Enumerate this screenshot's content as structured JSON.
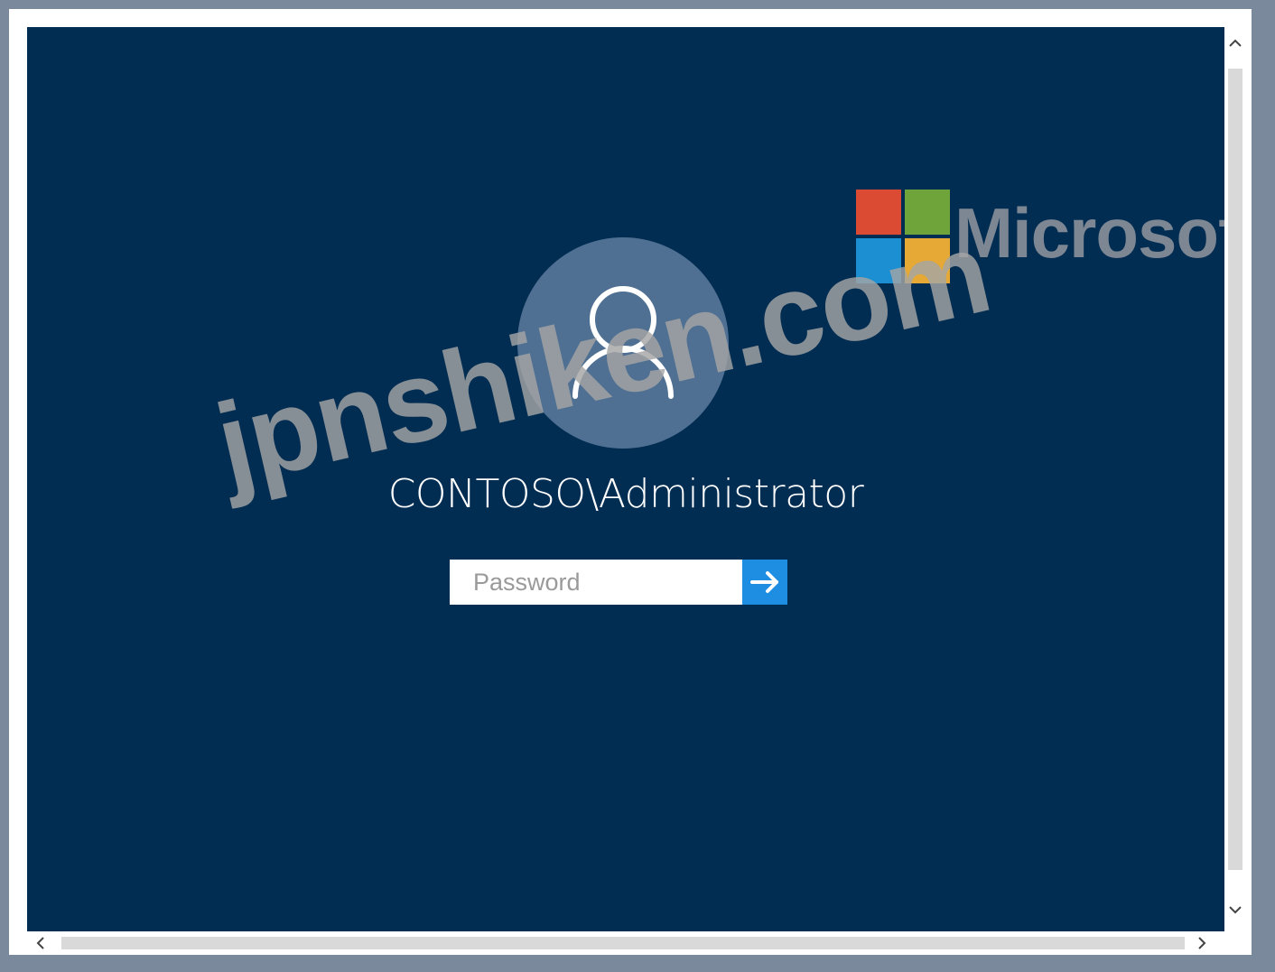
{
  "login": {
    "user_name": "CONTOSO\\Administrator",
    "password_placeholder": "Password",
    "password_value": ""
  },
  "branding": {
    "logo_text": "Microsoft",
    "logo_colors": [
      "#f25022",
      "#7fba00",
      "#00a4ef",
      "#ffb900"
    ]
  },
  "watermark": {
    "text": "jpnshiken.com"
  },
  "icons": {
    "avatar": "user-silhouette-icon",
    "submit": "arrow-right-icon",
    "scroll_up": "chevron-up-icon",
    "scroll_down": "chevron-down-icon",
    "scroll_left": "chevron-left-icon",
    "scroll_right": "chevron-right-icon"
  },
  "colors": {
    "background": "#022d52",
    "avatar_circle": "#4f7092",
    "submit_button": "#1e8ee3",
    "frame": "#7a8a9c"
  }
}
